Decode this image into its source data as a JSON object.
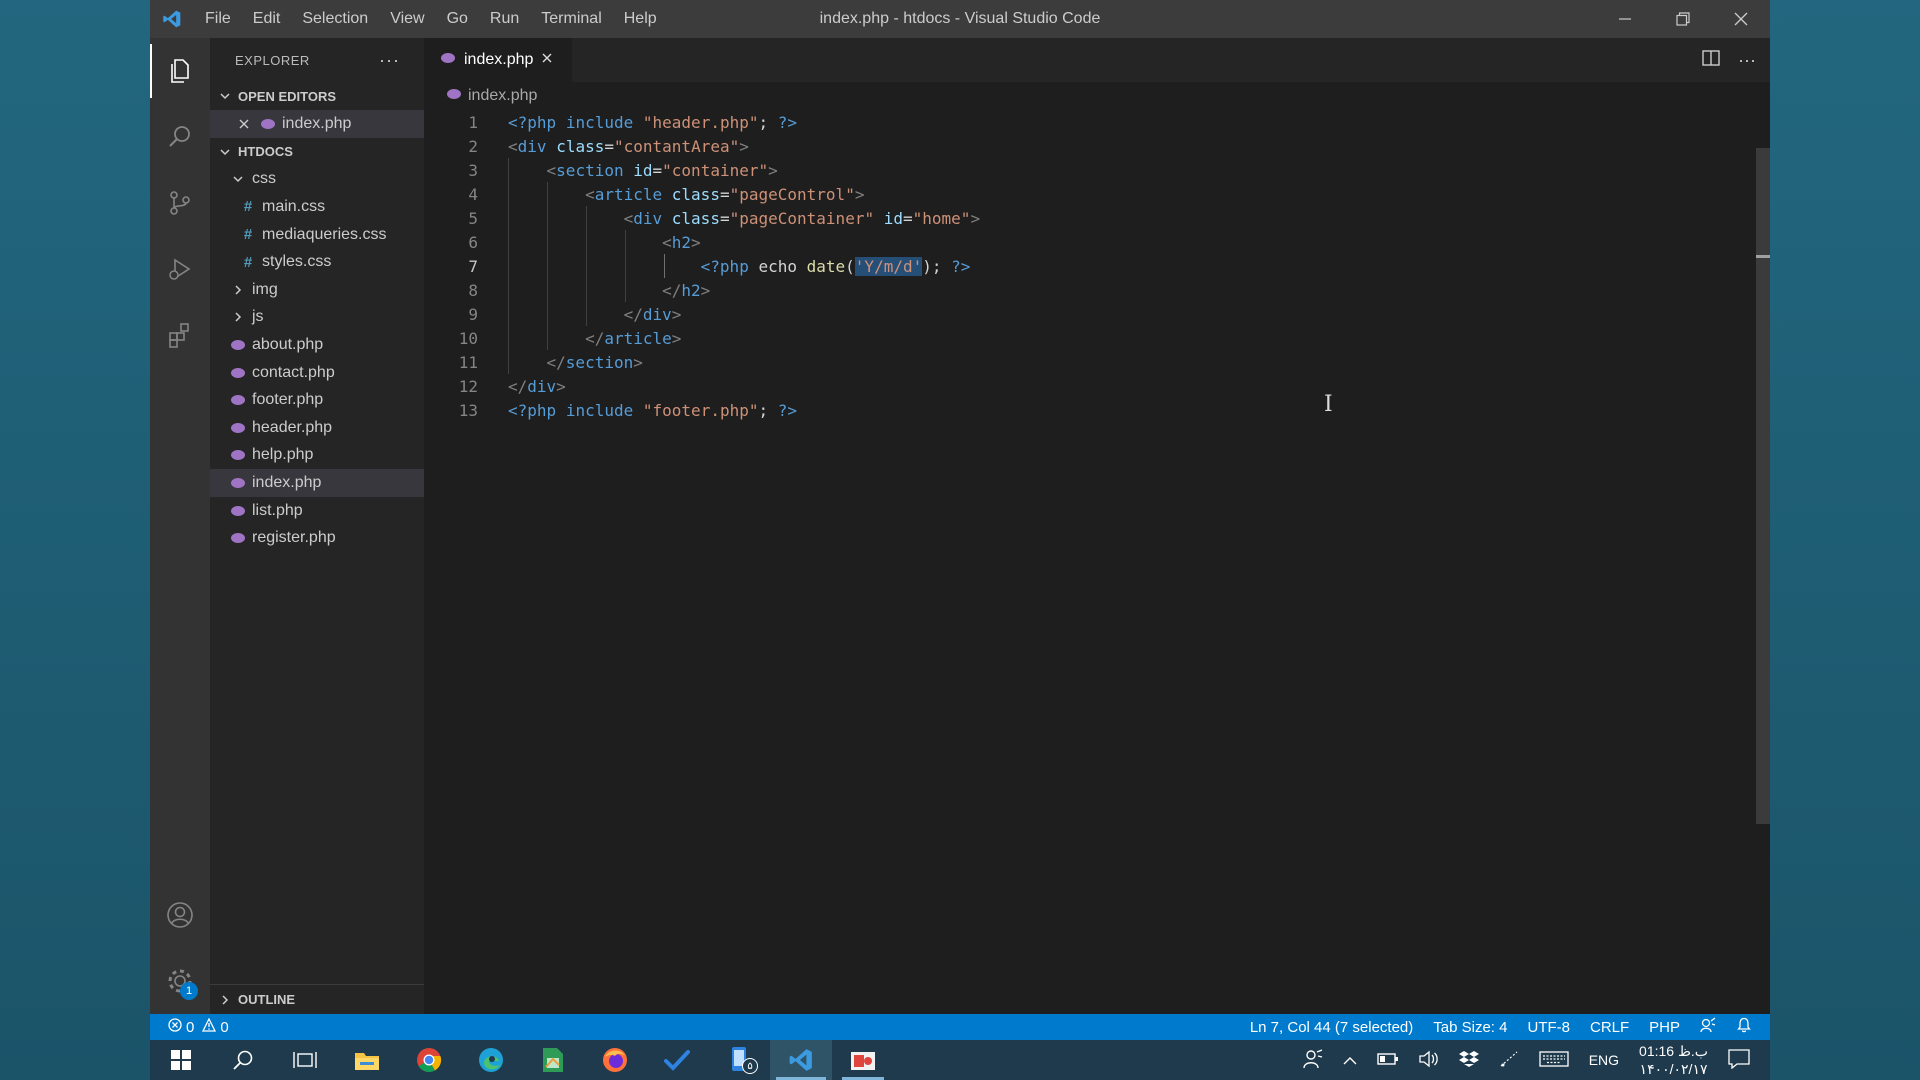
{
  "window": {
    "title": "index.php - htdocs - Visual Studio Code",
    "menu": [
      "File",
      "Edit",
      "Selection",
      "View",
      "Go",
      "Run",
      "Terminal",
      "Help"
    ]
  },
  "activity_bar": {
    "items": [
      "explorer-icon",
      "search-icon",
      "source-control-icon",
      "run-debug-icon",
      "extensions-icon"
    ],
    "bottom": [
      "account-icon",
      "settings-gear-icon"
    ],
    "settings_badge": "1"
  },
  "sidebar": {
    "title": "EXPLORER",
    "more": "···",
    "open_editors": {
      "header": "OPEN EDITORS",
      "items": [
        {
          "label": "index.php"
        }
      ]
    },
    "folder": {
      "header": "HTDOCS",
      "css_folder": "css",
      "css_files": [
        "main.css",
        "mediaqueries.css",
        "styles.css"
      ],
      "img_folder": "img",
      "js_folder": "js",
      "files": [
        "about.php",
        "contact.php",
        "footer.php",
        "header.php",
        "help.php",
        "index.php",
        "list.php",
        "register.php"
      ],
      "selected": "index.php"
    },
    "outline": "OUTLINE"
  },
  "editor": {
    "tab_label": "index.php",
    "breadcrumb": "index.php",
    "current_line": 7,
    "lines": [
      "1",
      "2",
      "3",
      "4",
      "5",
      "6",
      "7",
      "8",
      "9",
      "10",
      "11",
      "12",
      "13"
    ]
  },
  "status_bar": {
    "errors": "0",
    "warnings": "0",
    "position": "Ln 7, Col 44 (7 selected)",
    "tab_size": "Tab Size: 4",
    "encoding": "UTF-8",
    "eol": "CRLF",
    "language": "PHP"
  },
  "taskbar": {
    "apps": [
      "windows-start-icon",
      "search-icon",
      "task-view-icon",
      "file-explorer-icon",
      "chrome-icon",
      "edge-icon",
      "sheets-icon",
      "firefox-icon",
      "todo-icon",
      "phone-icon",
      "vscode-icon",
      "snip-icon"
    ],
    "phone_badge": "۵",
    "language": "ENG",
    "time": "01:16 ب.ظ",
    "date": "۱۴۰۰/۰۲/۱۷"
  },
  "colors": {
    "accent": "#007acc",
    "php_icon": "#a074c4",
    "css_icon": "#519aba"
  }
}
